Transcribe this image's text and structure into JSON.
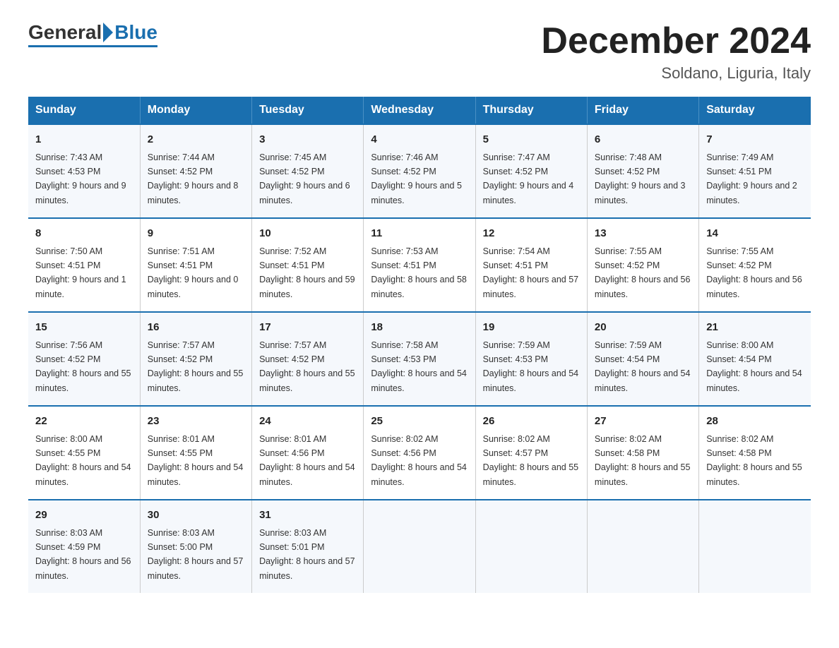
{
  "header": {
    "title": "December 2024",
    "location": "Soldano, Liguria, Italy",
    "logo_general": "General",
    "logo_blue": "Blue"
  },
  "days_of_week": [
    "Sunday",
    "Monday",
    "Tuesday",
    "Wednesday",
    "Thursday",
    "Friday",
    "Saturday"
  ],
  "weeks": [
    [
      {
        "day": "1",
        "sunrise": "7:43 AM",
        "sunset": "4:53 PM",
        "daylight": "9 hours and 9 minutes."
      },
      {
        "day": "2",
        "sunrise": "7:44 AM",
        "sunset": "4:52 PM",
        "daylight": "9 hours and 8 minutes."
      },
      {
        "day": "3",
        "sunrise": "7:45 AM",
        "sunset": "4:52 PM",
        "daylight": "9 hours and 6 minutes."
      },
      {
        "day": "4",
        "sunrise": "7:46 AM",
        "sunset": "4:52 PM",
        "daylight": "9 hours and 5 minutes."
      },
      {
        "day": "5",
        "sunrise": "7:47 AM",
        "sunset": "4:52 PM",
        "daylight": "9 hours and 4 minutes."
      },
      {
        "day": "6",
        "sunrise": "7:48 AM",
        "sunset": "4:52 PM",
        "daylight": "9 hours and 3 minutes."
      },
      {
        "day": "7",
        "sunrise": "7:49 AM",
        "sunset": "4:51 PM",
        "daylight": "9 hours and 2 minutes."
      }
    ],
    [
      {
        "day": "8",
        "sunrise": "7:50 AM",
        "sunset": "4:51 PM",
        "daylight": "9 hours and 1 minute."
      },
      {
        "day": "9",
        "sunrise": "7:51 AM",
        "sunset": "4:51 PM",
        "daylight": "9 hours and 0 minutes."
      },
      {
        "day": "10",
        "sunrise": "7:52 AM",
        "sunset": "4:51 PM",
        "daylight": "8 hours and 59 minutes."
      },
      {
        "day": "11",
        "sunrise": "7:53 AM",
        "sunset": "4:51 PM",
        "daylight": "8 hours and 58 minutes."
      },
      {
        "day": "12",
        "sunrise": "7:54 AM",
        "sunset": "4:51 PM",
        "daylight": "8 hours and 57 minutes."
      },
      {
        "day": "13",
        "sunrise": "7:55 AM",
        "sunset": "4:52 PM",
        "daylight": "8 hours and 56 minutes."
      },
      {
        "day": "14",
        "sunrise": "7:55 AM",
        "sunset": "4:52 PM",
        "daylight": "8 hours and 56 minutes."
      }
    ],
    [
      {
        "day": "15",
        "sunrise": "7:56 AM",
        "sunset": "4:52 PM",
        "daylight": "8 hours and 55 minutes."
      },
      {
        "day": "16",
        "sunrise": "7:57 AM",
        "sunset": "4:52 PM",
        "daylight": "8 hours and 55 minutes."
      },
      {
        "day": "17",
        "sunrise": "7:57 AM",
        "sunset": "4:52 PM",
        "daylight": "8 hours and 55 minutes."
      },
      {
        "day": "18",
        "sunrise": "7:58 AM",
        "sunset": "4:53 PM",
        "daylight": "8 hours and 54 minutes."
      },
      {
        "day": "19",
        "sunrise": "7:59 AM",
        "sunset": "4:53 PM",
        "daylight": "8 hours and 54 minutes."
      },
      {
        "day": "20",
        "sunrise": "7:59 AM",
        "sunset": "4:54 PM",
        "daylight": "8 hours and 54 minutes."
      },
      {
        "day": "21",
        "sunrise": "8:00 AM",
        "sunset": "4:54 PM",
        "daylight": "8 hours and 54 minutes."
      }
    ],
    [
      {
        "day": "22",
        "sunrise": "8:00 AM",
        "sunset": "4:55 PM",
        "daylight": "8 hours and 54 minutes."
      },
      {
        "day": "23",
        "sunrise": "8:01 AM",
        "sunset": "4:55 PM",
        "daylight": "8 hours and 54 minutes."
      },
      {
        "day": "24",
        "sunrise": "8:01 AM",
        "sunset": "4:56 PM",
        "daylight": "8 hours and 54 minutes."
      },
      {
        "day": "25",
        "sunrise": "8:02 AM",
        "sunset": "4:56 PM",
        "daylight": "8 hours and 54 minutes."
      },
      {
        "day": "26",
        "sunrise": "8:02 AM",
        "sunset": "4:57 PM",
        "daylight": "8 hours and 55 minutes."
      },
      {
        "day": "27",
        "sunrise": "8:02 AM",
        "sunset": "4:58 PM",
        "daylight": "8 hours and 55 minutes."
      },
      {
        "day": "28",
        "sunrise": "8:02 AM",
        "sunset": "4:58 PM",
        "daylight": "8 hours and 55 minutes."
      }
    ],
    [
      {
        "day": "29",
        "sunrise": "8:03 AM",
        "sunset": "4:59 PM",
        "daylight": "8 hours and 56 minutes."
      },
      {
        "day": "30",
        "sunrise": "8:03 AM",
        "sunset": "5:00 PM",
        "daylight": "8 hours and 57 minutes."
      },
      {
        "day": "31",
        "sunrise": "8:03 AM",
        "sunset": "5:01 PM",
        "daylight": "8 hours and 57 minutes."
      },
      null,
      null,
      null,
      null
    ]
  ],
  "labels": {
    "sunrise": "Sunrise:",
    "sunset": "Sunset:",
    "daylight": "Daylight:"
  }
}
